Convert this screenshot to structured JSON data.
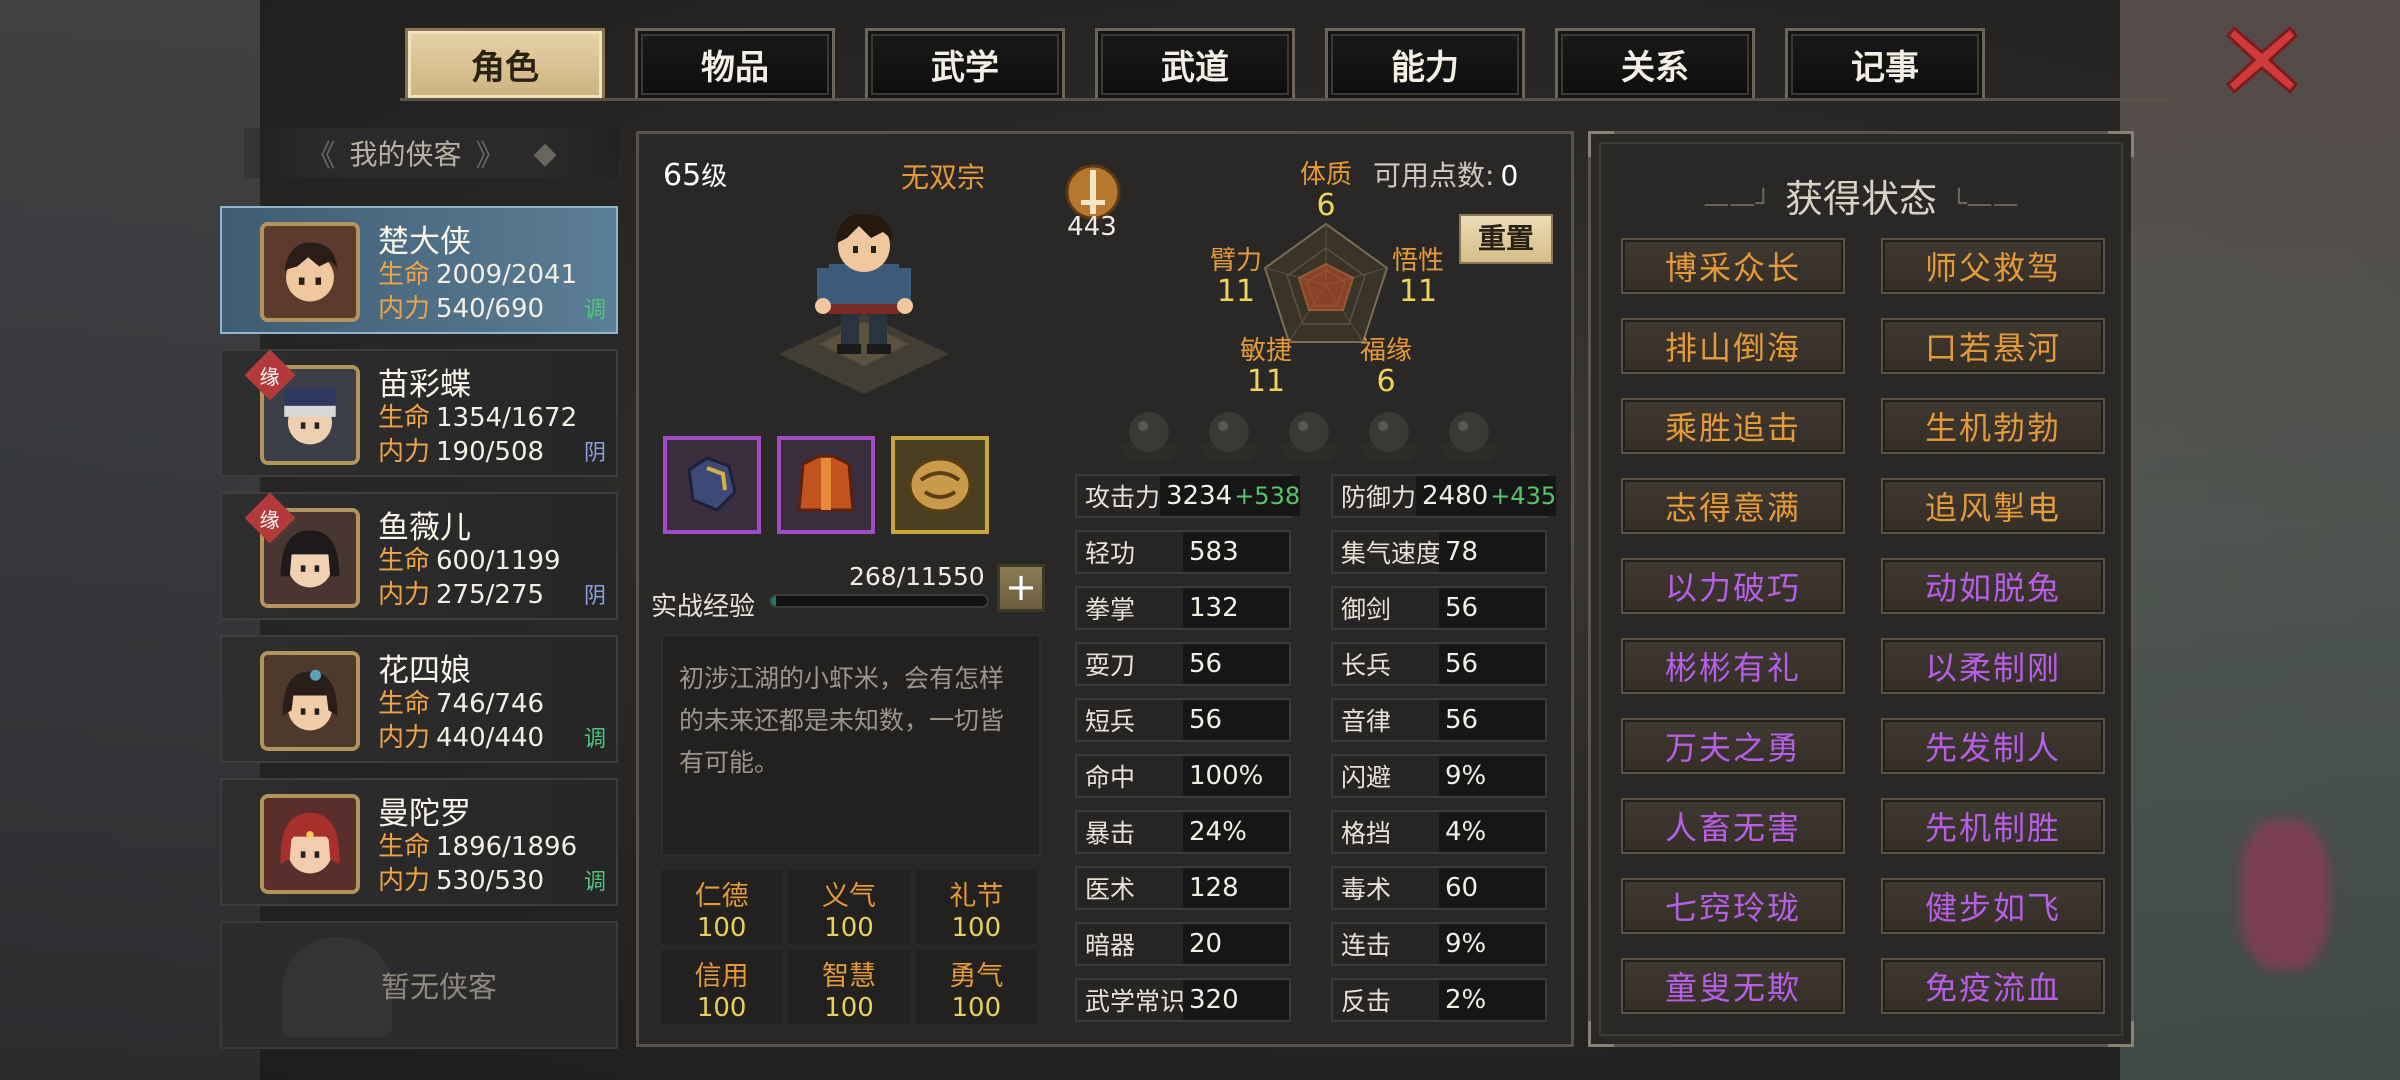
{
  "tabs": [
    {
      "label": "角色",
      "active": true
    },
    {
      "label": "物品",
      "active": false
    },
    {
      "label": "武学",
      "active": false
    },
    {
      "label": "武道",
      "active": false
    },
    {
      "label": "能力",
      "active": false
    },
    {
      "label": "关系",
      "active": false
    },
    {
      "label": "记事",
      "active": false
    }
  ],
  "close": {
    "icon": "close-x-icon",
    "color": "#d13a3a"
  },
  "roster": {
    "title": "我的侠客",
    "heroes": [
      {
        "name": "楚大侠",
        "hp_label": "生命",
        "hp": "2009/2041",
        "mp_label": "内力",
        "mp": "540/690",
        "tag": "调",
        "tag_color": "#4fc47c",
        "yuan": "",
        "selected": true
      },
      {
        "name": "苗彩蝶",
        "hp_label": "生命",
        "hp": "1354/1672",
        "mp_label": "内力",
        "mp": "190/508",
        "tag": "阴",
        "tag_color": "#8aa0e0",
        "yuan": "缘",
        "selected": false
      },
      {
        "name": "鱼薇儿",
        "hp_label": "生命",
        "hp": "600/1199",
        "mp_label": "内力",
        "mp": "275/275",
        "tag": "阴",
        "tag_color": "#8aa0e0",
        "yuan": "缘",
        "selected": false
      },
      {
        "name": "花四娘",
        "hp_label": "生命",
        "hp": "746/746",
        "mp_label": "内力",
        "mp": "440/440",
        "tag": "调",
        "tag_color": "#4fc47c",
        "yuan": "",
        "selected": false
      },
      {
        "name": "曼陀罗",
        "hp_label": "生命",
        "hp": "1896/1896",
        "mp_label": "内力",
        "mp": "530/530",
        "tag": "调",
        "tag_color": "#4fc47c",
        "yuan": "",
        "selected": false
      }
    ],
    "empty_label": "暂无侠客"
  },
  "character": {
    "level": "65",
    "level_suffix": "级",
    "sect": "无双宗",
    "weapon_value": "443",
    "exp_label": "实战经验",
    "exp": "268/11550",
    "exp_fraction": 0.023,
    "bio": "初涉江湖的小虾米，会有怎样的未来还都是未知数，一切皆有可能。",
    "virtues": [
      {
        "k": "仁德",
        "v": "100"
      },
      {
        "k": "义气",
        "v": "100"
      },
      {
        "k": "礼节",
        "v": "100"
      },
      {
        "k": "信用",
        "v": "100"
      },
      {
        "k": "智慧",
        "v": "100"
      },
      {
        "k": "勇气",
        "v": "100"
      }
    ]
  },
  "attributes": {
    "available_label": "可用点数:",
    "available": "0",
    "reset_label": "重置",
    "tizhi": {
      "label": "体质",
      "value": "6"
    },
    "wuxing": {
      "label": "悟性",
      "value": "11"
    },
    "fuyuan": {
      "label": "福缘",
      "value": "6"
    },
    "minjie": {
      "label": "敏捷",
      "value": "11"
    },
    "bili": {
      "label": "臂力",
      "value": "11"
    }
  },
  "stats": [
    {
      "k": "攻击力",
      "v": "3234",
      "bonus": "+538"
    },
    {
      "k": "防御力",
      "v": "2480",
      "bonus": "+435"
    },
    {
      "k": "轻功",
      "v": "583",
      "bonus": ""
    },
    {
      "k": "集气速度",
      "v": "78",
      "bonus": ""
    },
    {
      "k": "拳掌",
      "v": "132",
      "bonus": ""
    },
    {
      "k": "御剑",
      "v": "56",
      "bonus": ""
    },
    {
      "k": "耍刀",
      "v": "56",
      "bonus": ""
    },
    {
      "k": "长兵",
      "v": "56",
      "bonus": ""
    },
    {
      "k": "短兵",
      "v": "56",
      "bonus": ""
    },
    {
      "k": "音律",
      "v": "56",
      "bonus": ""
    },
    {
      "k": "命中",
      "v": "100%",
      "bonus": ""
    },
    {
      "k": "闪避",
      "v": "9%",
      "bonus": ""
    },
    {
      "k": "暴击",
      "v": "24%",
      "bonus": ""
    },
    {
      "k": "格挡",
      "v": "4%",
      "bonus": ""
    },
    {
      "k": "医术",
      "v": "128",
      "bonus": ""
    },
    {
      "k": "毒术",
      "v": "60",
      "bonus": ""
    },
    {
      "k": "暗器",
      "v": "20",
      "bonus": ""
    },
    {
      "k": "连击",
      "v": "9%",
      "bonus": ""
    },
    {
      "k": "武学常识",
      "v": "320",
      "bonus": ""
    },
    {
      "k": "反击",
      "v": "2%",
      "bonus": ""
    }
  ],
  "status": {
    "title": "获得状态",
    "items": [
      {
        "label": "博采众长",
        "color": "#e49a38"
      },
      {
        "label": "师父救驾",
        "color": "#e49a38"
      },
      {
        "label": "排山倒海",
        "color": "#e49a38"
      },
      {
        "label": "口若悬河",
        "color": "#e49a38"
      },
      {
        "label": "乘胜追击",
        "color": "#e49a38"
      },
      {
        "label": "生机勃勃",
        "color": "#e49a38"
      },
      {
        "label": "志得意满",
        "color": "#e49a38"
      },
      {
        "label": "追风掣电",
        "color": "#e49a38"
      },
      {
        "label": "以力破巧",
        "color": "#b65ee8"
      },
      {
        "label": "动如脱兔",
        "color": "#b65ee8"
      },
      {
        "label": "彬彬有礼",
        "color": "#b65ee8"
      },
      {
        "label": "以柔制刚",
        "color": "#b65ee8"
      },
      {
        "label": "万夫之勇",
        "color": "#b65ee8"
      },
      {
        "label": "先发制人",
        "color": "#b65ee8"
      },
      {
        "label": "人畜无害",
        "color": "#b65ee8"
      },
      {
        "label": "先机制胜",
        "color": "#b65ee8"
      },
      {
        "label": "七窍玲珑",
        "color": "#b65ee8"
      },
      {
        "label": "健步如飞",
        "color": "#b65ee8"
      },
      {
        "label": "童叟无欺",
        "color": "#b65ee8"
      },
      {
        "label": "免疫流血",
        "color": "#b65ee8"
      }
    ]
  },
  "equipment": [
    {
      "icon": "glove-icon",
      "rarity_color": "#a14cc5"
    },
    {
      "icon": "armor-icon",
      "rarity_color": "#a14cc5"
    },
    {
      "icon": "amulet-icon",
      "rarity_color": "#c8a43c"
    }
  ]
}
